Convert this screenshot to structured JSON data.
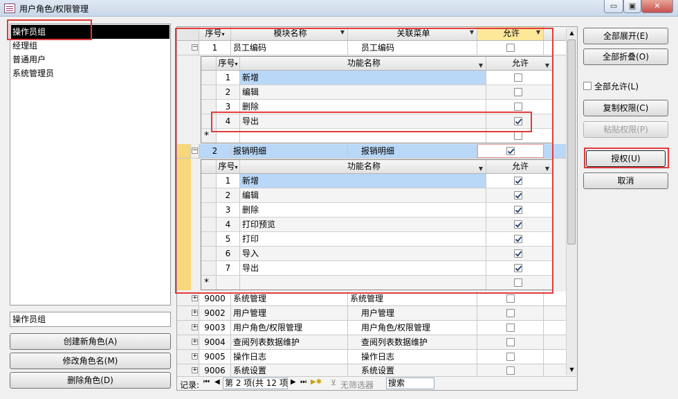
{
  "window": {
    "title": "用户角色/权限管理",
    "min": "▭",
    "max": "▣",
    "close": "✕"
  },
  "roles": [
    "操作员组",
    "经理组",
    "普通用户",
    "系统管理员"
  ],
  "role_name_value": "操作员组",
  "left_buttons": {
    "create": "创建新角色(A)",
    "rename": "修改角色名(M)",
    "delete": "删除角色(D)"
  },
  "right_buttons": {
    "expand_all": "全部展开(E)",
    "collapse_all": "全部折叠(O)",
    "allow_all": "全部允许(L)",
    "copy": "复制权限(C)",
    "paste": "粘贴权限(P)",
    "grant": "授权(U)",
    "cancel": "取消"
  },
  "main_grid": {
    "headers": {
      "seq": "序号",
      "module": "模块名称",
      "menu": "关联菜单",
      "allow": "允许"
    }
  },
  "sub_headers": {
    "seq": "序号",
    "func": "功能名称",
    "allow": "允许"
  },
  "modules": [
    {
      "seq": "1",
      "name": "员工编码",
      "menu": "员工编码",
      "allowed": false,
      "funcs": [
        {
          "seq": "1",
          "name": "新增",
          "allowed": false
        },
        {
          "seq": "2",
          "name": "编辑",
          "allowed": false
        },
        {
          "seq": "3",
          "name": "删除",
          "allowed": false
        },
        {
          "seq": "4",
          "name": "导出",
          "allowed": true
        }
      ]
    },
    {
      "seq": "2",
      "name": "报销明细",
      "menu": "报销明细",
      "allowed": true,
      "funcs": [
        {
          "seq": "1",
          "name": "新增",
          "allowed": true
        },
        {
          "seq": "2",
          "name": "编辑",
          "allowed": true
        },
        {
          "seq": "3",
          "name": "删除",
          "allowed": true
        },
        {
          "seq": "4",
          "name": "打印预览",
          "allowed": true
        },
        {
          "seq": "5",
          "name": "打印",
          "allowed": true
        },
        {
          "seq": "6",
          "name": "导入",
          "allowed": true
        },
        {
          "seq": "7",
          "name": "导出",
          "allowed": true
        }
      ]
    }
  ],
  "collapsed": [
    {
      "seq": "9000",
      "name": "系统管理",
      "menu": "系统管理",
      "allowed": false
    },
    {
      "seq": "9002",
      "name": "用户管理",
      "menu": "用户管理",
      "allowed": false
    },
    {
      "seq": "9003",
      "name": "用户角色/权限管理",
      "menu": "用户角色/权限管理",
      "allowed": false
    },
    {
      "seq": "9004",
      "name": "查阅列表数据维护",
      "menu": "查阅列表数据维护",
      "allowed": false
    },
    {
      "seq": "9005",
      "name": "操作日志",
      "menu": "操作日志",
      "allowed": false
    },
    {
      "seq": "9006",
      "name": "系统设置",
      "menu": "系统设置",
      "allowed": false
    }
  ],
  "nav": {
    "label": "记录:",
    "record": "第 2 项(共 12 项",
    "filter": "无筛选器",
    "search": "搜索"
  },
  "colors": {
    "selected_row": "#b9d7f7",
    "record_selector_yellow": "#f6d77a",
    "highlight_red": "#e23a3a"
  }
}
